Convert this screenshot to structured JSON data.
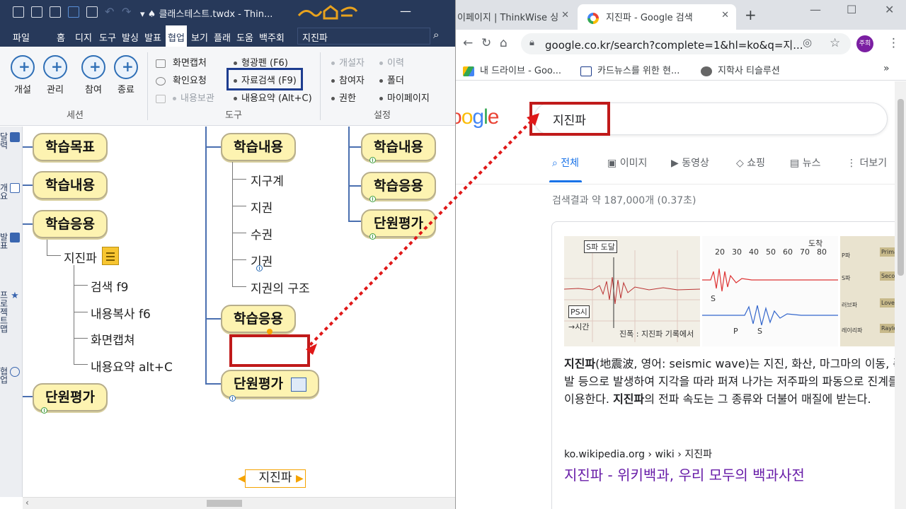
{
  "thinkwise": {
    "title": "클래스테스트.twdx - Thin...",
    "menu": [
      "파일",
      "홈",
      "디지",
      "도구",
      "발싱",
      "발표",
      "협업",
      "보기",
      "플래",
      "도움",
      "백주회"
    ],
    "menu_active": "협업",
    "search_value": "지진파",
    "ribbon": {
      "session": {
        "label": "세션",
        "buttons": [
          "개설",
          "관리",
          "참여",
          "종료"
        ]
      },
      "tools": {
        "label": "도구",
        "items": [
          "화면캡처",
          "확인요청",
          "내용보관",
          "형광펜 (F6)",
          "자료검색 (F9)",
          "내용요약 (Alt+C)"
        ]
      },
      "settings": {
        "label": "설정",
        "items": [
          "개설자",
          "참여자",
          "권한",
          "이력",
          "폴더",
          "마이페이지"
        ]
      }
    },
    "side_tabs": [
      "달력",
      "개요",
      "발표",
      "프로젝트맵",
      "협업"
    ],
    "map": {
      "col1": {
        "nodes": [
          "학습목표",
          "학습내용",
          "학습응용",
          "단원평가"
        ],
        "child": "지진파",
        "leaves": [
          "검색 f9",
          "내용복사 f6",
          "화면캡쳐",
          "내용요약 alt+C"
        ]
      },
      "col2": {
        "node_top": "학습내용",
        "leaves": [
          "지구계",
          "지권",
          "수권",
          "기권",
          "지권의 구조"
        ],
        "node_mid": "학습응용",
        "selected": "지진파",
        "node_bottom": "단원평가"
      },
      "col3": {
        "nodes": [
          "학습내용",
          "학습응용",
          "단원평가"
        ]
      }
    }
  },
  "chrome": {
    "tab_inactive": "이페이지 | ThinkWise 싱",
    "tab_active": "지진파 - Google 검색",
    "url": "google.co.kr/search?complete=1&hl=ko&q=지...",
    "avatar": "주희",
    "bookmarks": [
      "내 드라이브 - Goo...",
      "카드뉴스를 위한 현...",
      "지학사 티슬루션"
    ],
    "google": {
      "logo": "oogle",
      "query": "지진파",
      "nav": [
        "전체",
        "이미지",
        "동영상",
        "쇼핑",
        "뉴스",
        "더보기"
      ],
      "stats": "검색결과 약 187,000개 (0.37초)",
      "img1_labels": [
        "S파 도달",
        "PS시",
        "→시간",
        "진폭 : 지진파 기록에서"
      ],
      "img2_labels": [
        "도착",
        "20",
        "30",
        "40",
        "50",
        "60",
        "70",
        "80",
        "S",
        "P",
        "S"
      ],
      "img3_labels": [
        "P파",
        "S파",
        "러브파",
        "레이리파",
        "Primary",
        "Second",
        "Love wa",
        "Rayleigh"
      ],
      "desc_bold": "지진파",
      "desc_1": "(地震波, 영어: seismic wave)는 지진, 화산, 마그마의 이동, 폭발 등으로 발생하여 지각을 따라 퍼져 나가는 저주파의 파동으로 진계를 이용한다. ",
      "desc_bold2": "지진파",
      "desc_2": "의 전파 속도는 그 종류와 더불어 매질에 받는다.",
      "source": "ko.wikipedia.org › wiki › 지진파",
      "link": "지진파 - 위키백과, 우리 모두의 백과사전"
    }
  },
  "colors": {
    "accent_red": "#c01a1a",
    "tw_dark": "#27395a",
    "google_blue": "#1a73e8",
    "visited": "#681da8"
  }
}
